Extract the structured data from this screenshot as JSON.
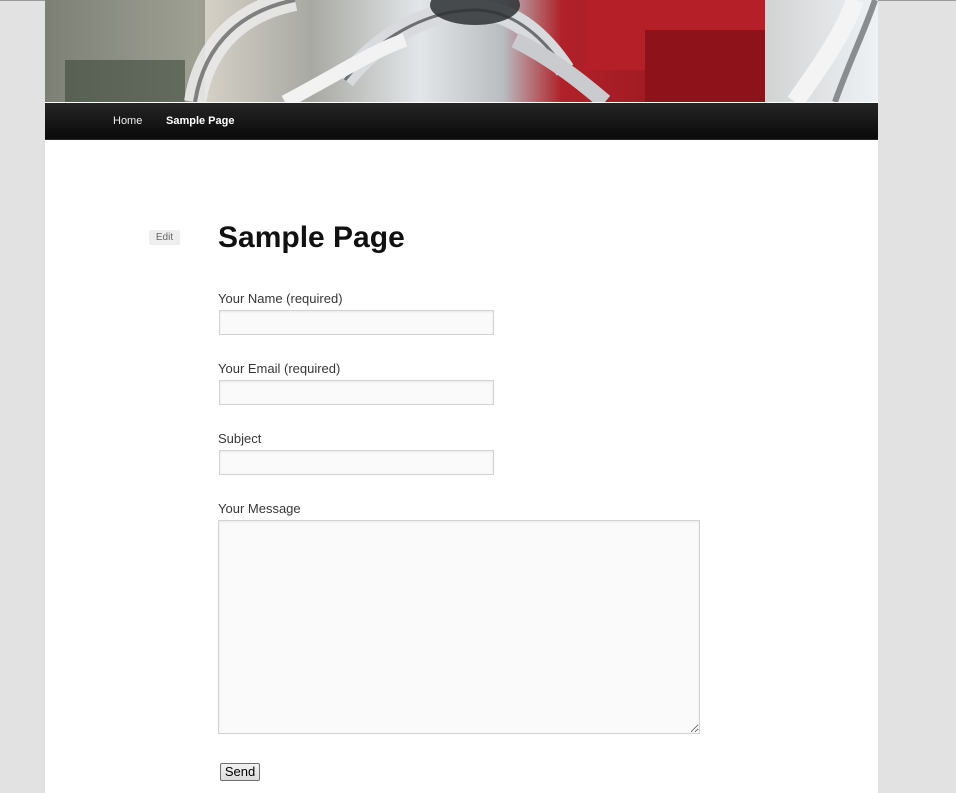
{
  "nav": {
    "items": [
      {
        "label": "Home"
      },
      {
        "label": "Sample Page"
      }
    ]
  },
  "edit_label": "Edit",
  "page_title": "Sample Page",
  "form": {
    "name_label": "Your Name (required)",
    "name_value": "",
    "email_label": "Your Email (required)",
    "email_value": "",
    "subject_label": "Subject",
    "subject_value": "",
    "message_label": "Your Message",
    "message_value": "",
    "send_label": "Send"
  },
  "colors": {
    "nav_background": "#111111",
    "page_background": "#ffffff",
    "outer_background": "#e2e2e2",
    "header_accent": "#b1212a"
  }
}
